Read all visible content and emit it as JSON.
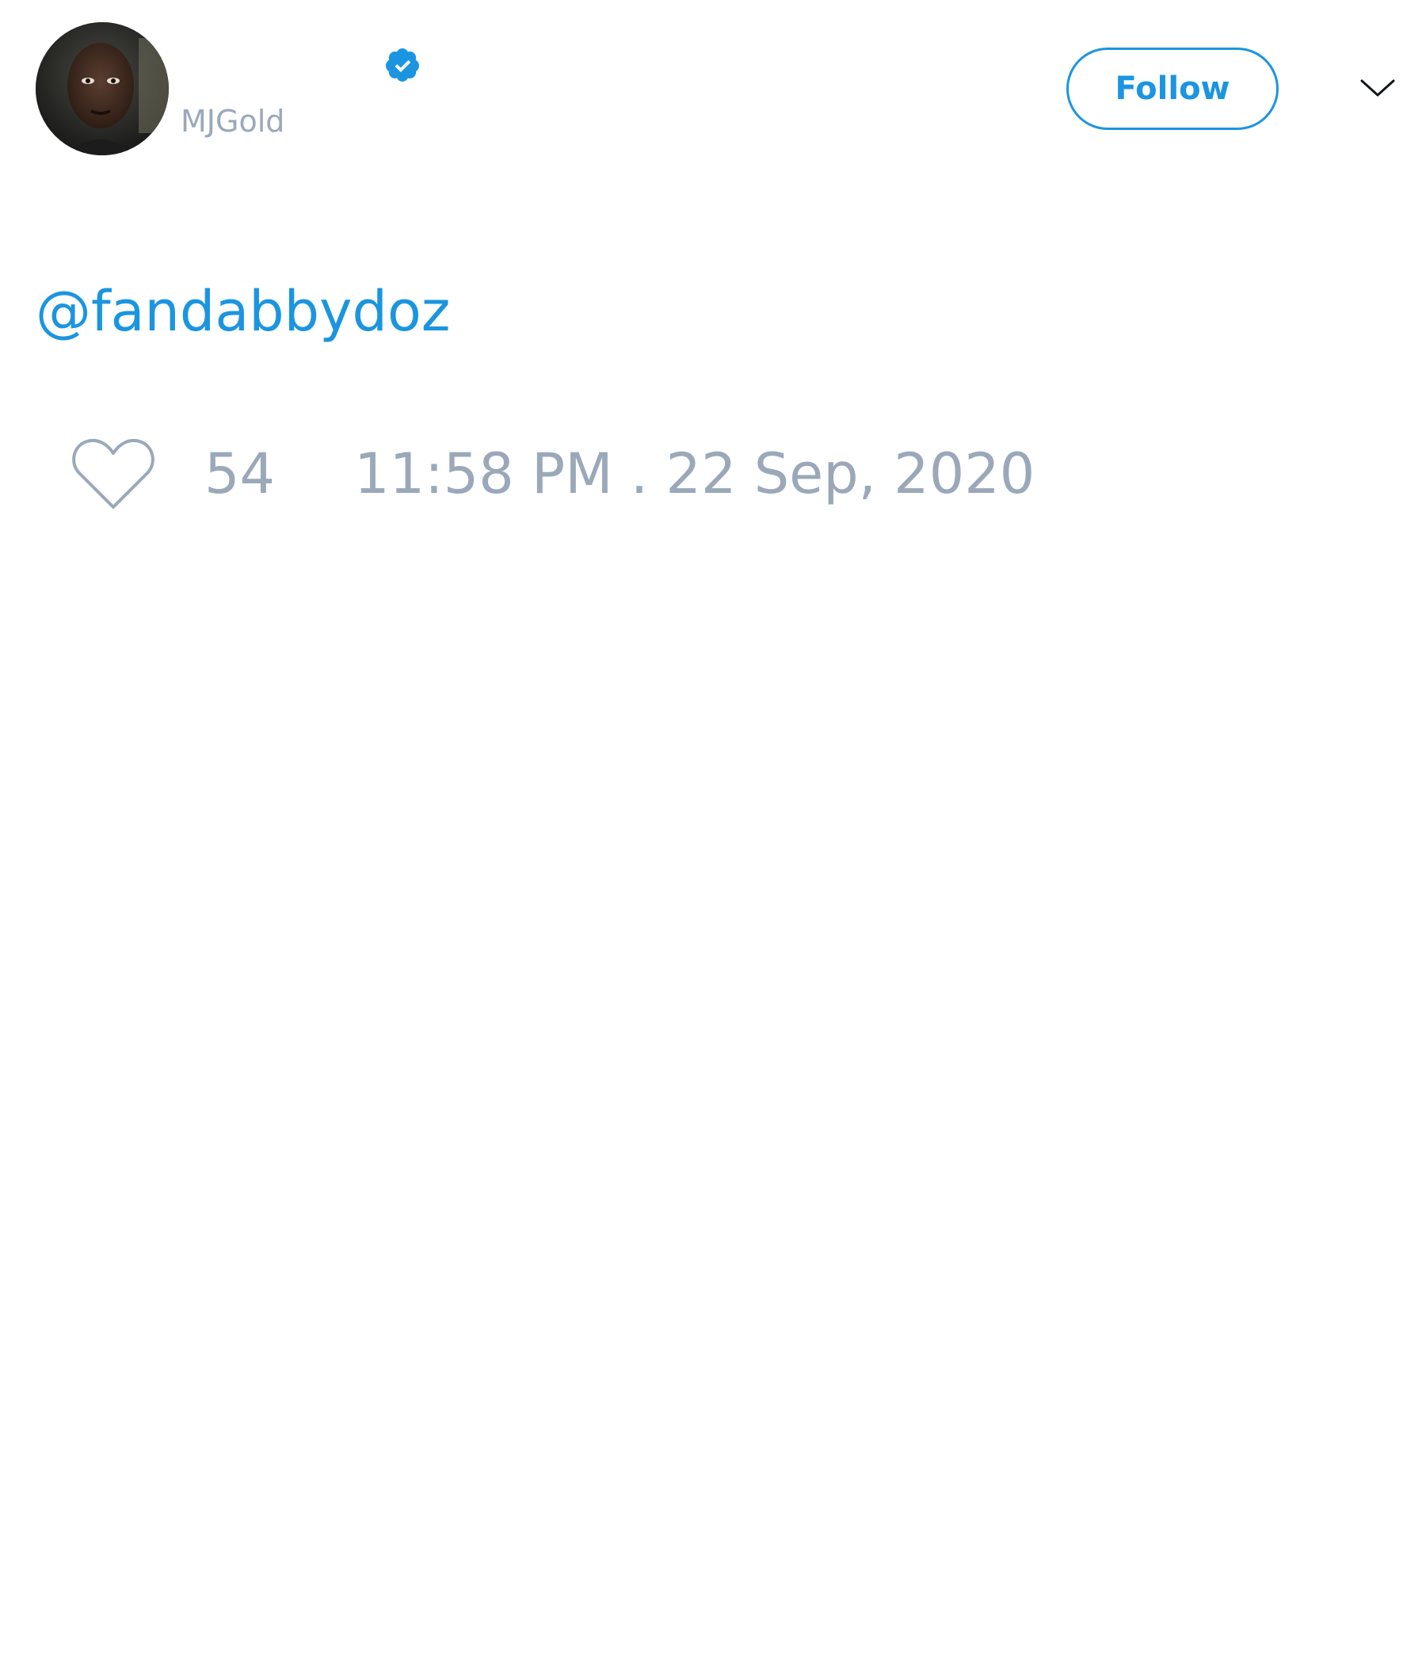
{
  "author": {
    "handle": "MJGold",
    "verified": true
  },
  "header": {
    "follow_label": "Follow"
  },
  "tweet": {
    "text": "@fandabbydoz",
    "like_count": "54",
    "timestamp": "11:58 PM . 22 Sep, 2020"
  },
  "colors": {
    "accent": "#1b95e0",
    "muted_text": "#9aa8ba",
    "background": "#ffffff"
  },
  "icons": {
    "verified": "verified-badge-icon",
    "menu": "chevron-down-icon",
    "like": "heart-icon"
  }
}
